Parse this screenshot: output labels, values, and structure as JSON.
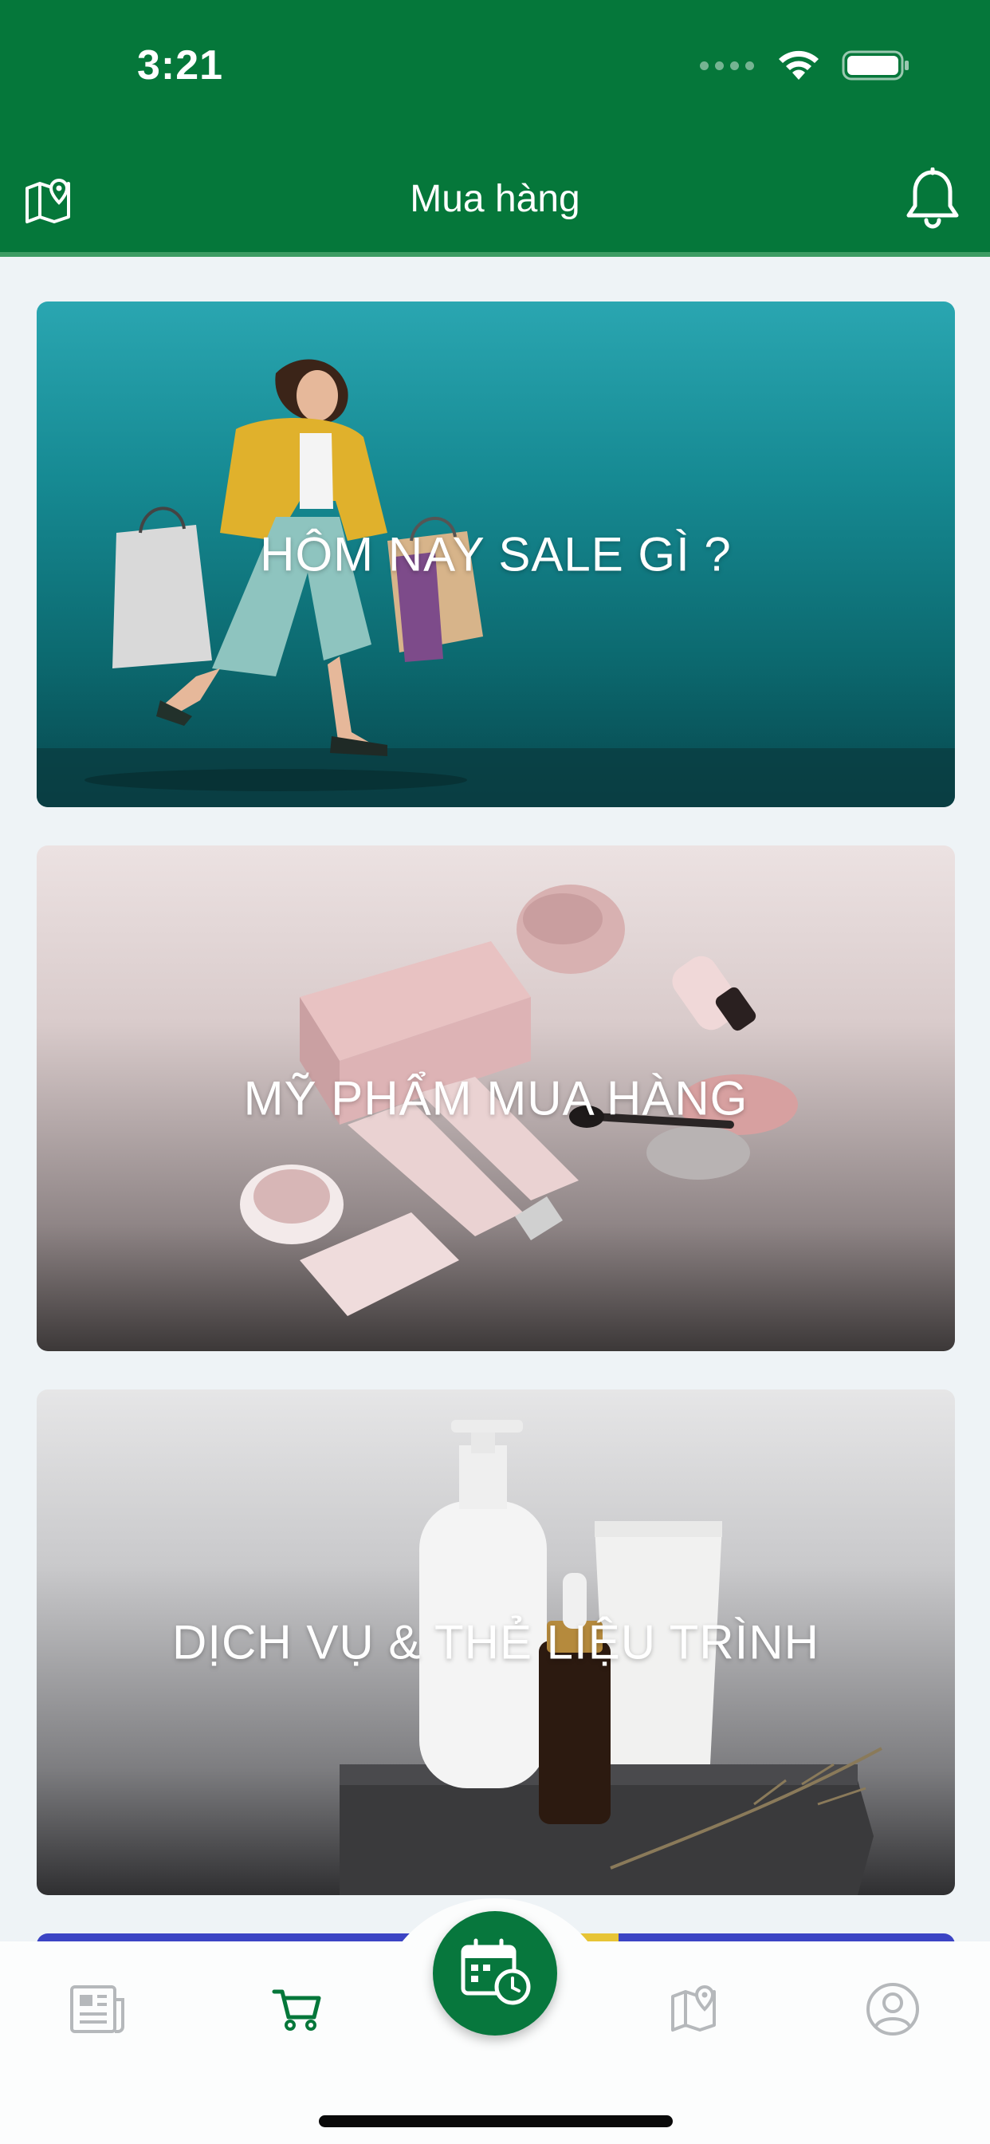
{
  "status_bar": {
    "time": "3:21"
  },
  "header": {
    "title": "Mua hàng",
    "left_icon": "map-pin-icon",
    "right_icon": "bell-icon",
    "background_color": "#05773a"
  },
  "cards": [
    {
      "label": "HÔM NAY SALE GÌ ?",
      "image": "woman-with-shopping-bags"
    },
    {
      "label": "MỸ PHẨM MUA HÀNG",
      "image": "cosmetic-products"
    },
    {
      "label": "DỊCH VỤ & THẺ LIỆU TRÌNH",
      "image": "skincare-bottles"
    }
  ],
  "tab_bar": {
    "items": [
      {
        "icon": "newspaper-icon",
        "active": false
      },
      {
        "icon": "shopping-cart-icon",
        "active": true
      },
      {
        "icon": "calendar-clock-icon",
        "center": true
      },
      {
        "icon": "map-pin-icon",
        "active": false
      },
      {
        "icon": "user-circle-icon",
        "active": false
      }
    ],
    "active_color": "#05773a",
    "inactive_color": "#b5b8bb"
  }
}
